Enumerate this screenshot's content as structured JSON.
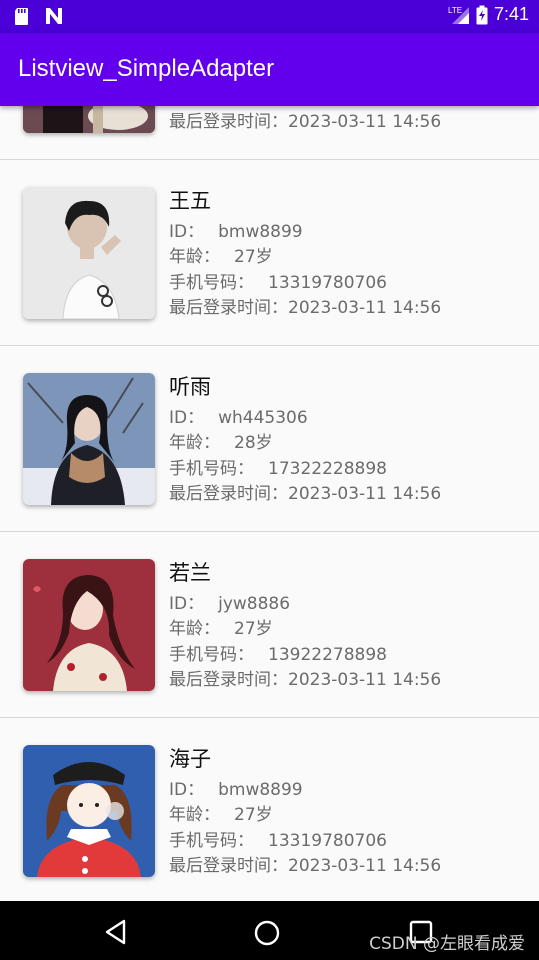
{
  "status_bar": {
    "time": "7:41",
    "network": "LTE",
    "icons": [
      "sd-card-icon",
      "n-notification-icon",
      "lte-signal-icon",
      "battery-charging-icon"
    ]
  },
  "app_bar": {
    "title": "Listview_SimpleAdapter"
  },
  "labels": {
    "id": "ID：",
    "age": "年龄：",
    "phone": "手机号码：",
    "last_login": "最后登录时间："
  },
  "items": [
    {
      "name": "",
      "id": "",
      "age": "",
      "phone": "",
      "last_login": "2023-03-11 14:56"
    },
    {
      "name": "王五",
      "id": "bmw8899",
      "age": "27岁",
      "phone": "13319780706",
      "last_login": "2023-03-11 14:56"
    },
    {
      "name": "听雨",
      "id": "wh445306",
      "age": "28岁",
      "phone": "17322228898",
      "last_login": "2023-03-11 14:56"
    },
    {
      "name": "若兰",
      "id": "jyw8886",
      "age": "27岁",
      "phone": "13922278898",
      "last_login": "2023-03-11 14:56"
    },
    {
      "name": "海子",
      "id": "bmw8899",
      "age": "27岁",
      "phone": "13319780706",
      "last_login": "2023-03-11 14:56"
    }
  ],
  "nav_bar": {
    "icons": [
      "back-icon",
      "home-icon",
      "recents-icon"
    ],
    "watermark": "CSDN @左眼看成爱"
  },
  "colors": {
    "status_bar": "#4a00d6",
    "app_bar": "#6200ee",
    "list_background": "#fafafa",
    "nav_bar": "#000000"
  }
}
